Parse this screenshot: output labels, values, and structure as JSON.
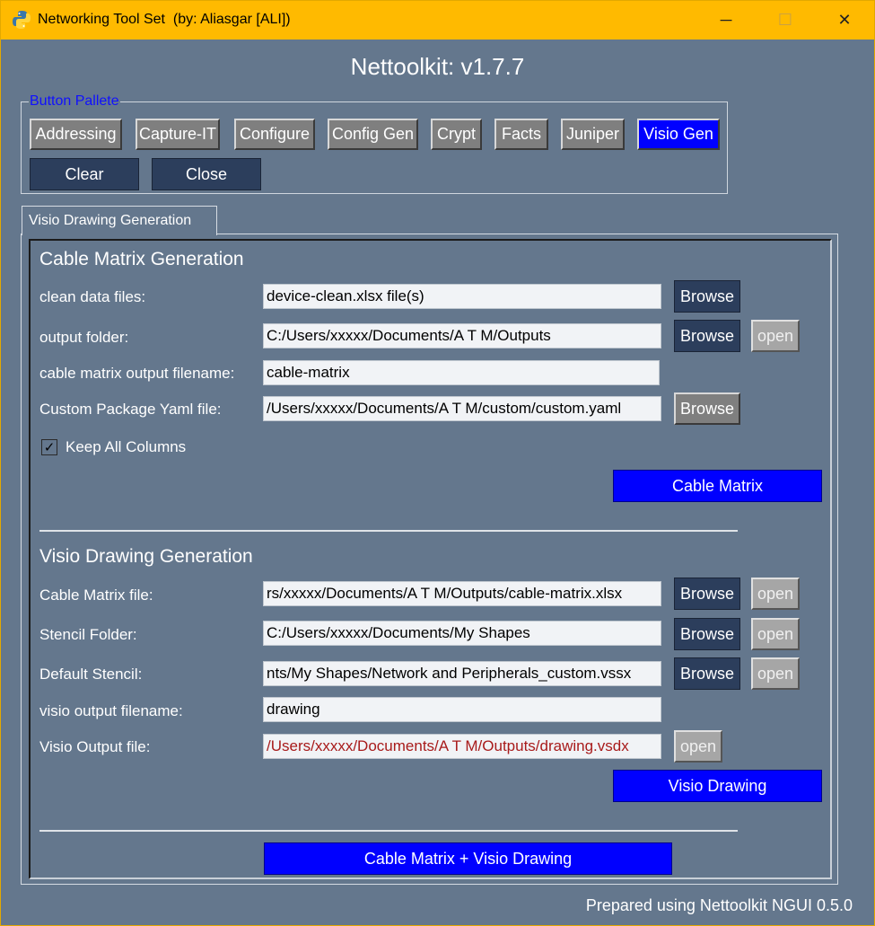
{
  "window": {
    "title": "Networking Tool Set  (by: Aliasgar [ALI])",
    "minimize_glyph": "─",
    "maximize_glyph": "☐",
    "close_glyph": "✕"
  },
  "app_title": "Nettoolkit: v1.7.7",
  "palette": {
    "legend": "Button Pallete",
    "buttons": [
      "Addressing",
      "Capture-IT",
      "Configure",
      "Config Gen",
      "Crypt",
      "Facts",
      "Juniper",
      "Visio Gen"
    ],
    "active": "Visio Gen",
    "clear_label": "Clear",
    "close_label": "Close"
  },
  "tab": {
    "label": "Visio Drawing Generation"
  },
  "cable_matrix": {
    "title": "Cable Matrix Generation",
    "clean_data": {
      "label": "clean data files:",
      "value": "device-clean.xlsx file(s)",
      "browse": "Browse"
    },
    "output_folder": {
      "label": "output folder:",
      "value": "C:/Users/xxxxx/Documents/A T M/Outputs",
      "browse": "Browse",
      "open": "open"
    },
    "output_filename": {
      "label": "cable matrix output filename:",
      "value": "cable-matrix"
    },
    "custom_yaml": {
      "label": "Custom Package Yaml file:",
      "value": "/Users/xxxxx/Documents/A T M/custom/custom.yaml",
      "browse": "Browse"
    },
    "keep_columns": {
      "label": "Keep All Columns",
      "checked": true,
      "mark": "✓"
    },
    "run_label": "Cable Matrix"
  },
  "visio": {
    "title": "Visio Drawing Generation",
    "cable_matrix_file": {
      "label": "Cable Matrix file:",
      "value": "rs/xxxxx/Documents/A T M/Outputs/cable-matrix.xlsx",
      "browse": "Browse",
      "open": "open"
    },
    "stencil_folder": {
      "label": "Stencil Folder:",
      "value": "C:/Users/xxxxx/Documents/My Shapes",
      "browse": "Browse",
      "open": "open"
    },
    "default_stencil": {
      "label": "Default Stencil:",
      "value": "nts/My Shapes/Network and Peripherals_custom.vssx",
      "browse": "Browse",
      "open": "open"
    },
    "output_filename": {
      "label": "visio output filename:",
      "value": "drawing"
    },
    "output_file": {
      "label": "Visio Output file:",
      "value": "/Users/xxxxx/Documents/A T M/Outputs/drawing.vsdx",
      "open": "open"
    },
    "run_label": "Visio Drawing"
  },
  "combined_label": "Cable Matrix + Visio Drawing",
  "footer": "Prepared using Nettoolkit NGUI 0.5.0",
  "colors": {
    "background": "#64778d",
    "title_bar": "#ffba00",
    "accent_blue": "#0000ff",
    "dark_button": "#2c3e5c",
    "legend_text": "#1010ff",
    "error_text": "#a81b1b"
  }
}
